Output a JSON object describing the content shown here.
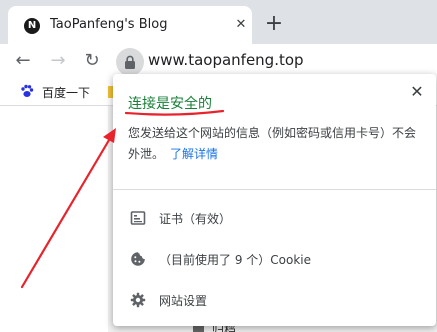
{
  "tab": {
    "favicon_letter": "N",
    "title": "TaoPanfeng's Blog",
    "close_symbol": "✕",
    "new_tab_symbol": "+"
  },
  "toolbar": {
    "back_symbol": "←",
    "forward_symbol": "→",
    "reload_symbol": "↻",
    "url": "www.taopanfeng.top"
  },
  "bookmarks": {
    "items": [
      {
        "label": "百度一下",
        "icon": "baidu-paw-icon"
      }
    ]
  },
  "page": {
    "footer_text": "归档"
  },
  "popup": {
    "close_symbol": "✕",
    "title": "连接是安全的",
    "description": "您发送给这个网站的信息（例如密码或信用卡号）不会外泄。",
    "learn_more": "了解详情",
    "rows": [
      {
        "label": "证书（有效）",
        "icon": "certificate-icon"
      },
      {
        "label": "（目前使用了 9 个）Cookie",
        "icon": "cookie-icon"
      },
      {
        "label": "网站设置",
        "icon": "gear-icon"
      }
    ]
  },
  "colors": {
    "secure_green": "#188038",
    "link_blue": "#1a73e8",
    "annotation_red": "#e8232c"
  }
}
